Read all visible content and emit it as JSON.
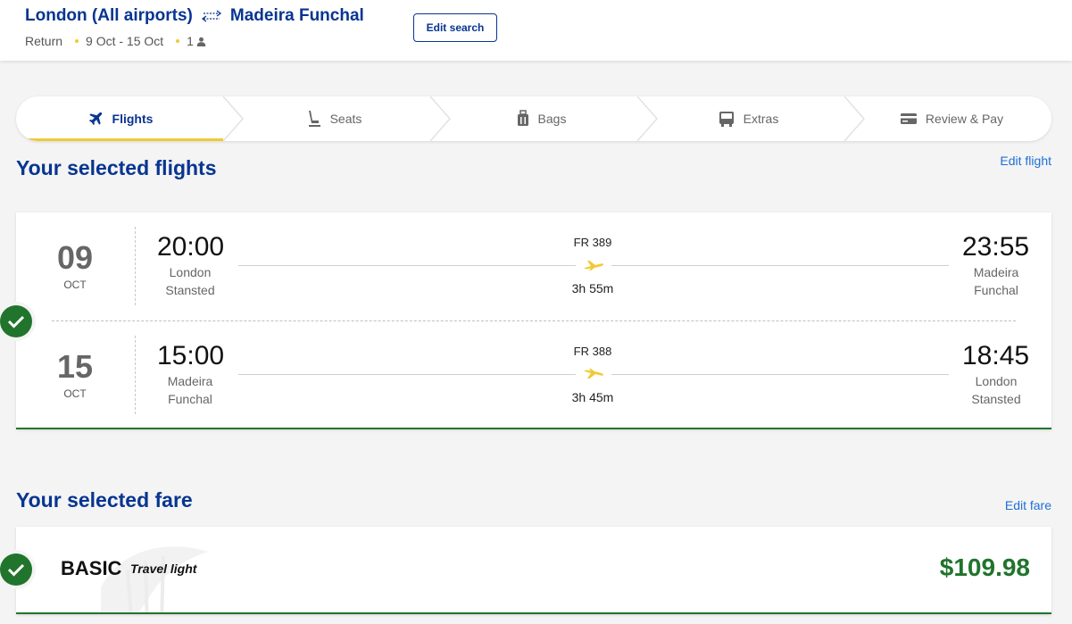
{
  "header": {
    "origin": "London (All airports)",
    "destination": "Madeira Funchal",
    "trip_type": "Return",
    "dates": "9 Oct - 15 Oct",
    "passengers": "1",
    "edit_search_label": "Edit search"
  },
  "stepper": {
    "steps": [
      {
        "label": "Flights",
        "icon": "plane-icon",
        "active": true
      },
      {
        "label": "Seats",
        "icon": "seat-icon",
        "active": false
      },
      {
        "label": "Bags",
        "icon": "bag-icon",
        "active": false
      },
      {
        "label": "Extras",
        "icon": "bus-icon",
        "active": false
      },
      {
        "label": "Review & Pay",
        "icon": "card-icon",
        "active": false
      }
    ]
  },
  "flights_section": {
    "title": "Your selected flights",
    "edit_label": "Edit flight",
    "legs": [
      {
        "day": "09",
        "month": "OCT",
        "depart_time": "20:00",
        "depart_place_line1": "London",
        "depart_place_line2": "Stansted",
        "flight_number": "FR 389",
        "duration": "3h 55m",
        "arrive_time": "23:55",
        "arrive_place_line1": "Madeira",
        "arrive_place_line2": "Funchal"
      },
      {
        "day": "15",
        "month": "OCT",
        "depart_time": "15:00",
        "depart_place_line1": "Madeira",
        "depart_place_line2": "Funchal",
        "flight_number": "FR 388",
        "duration": "3h 45m",
        "arrive_time": "18:45",
        "arrive_place_line1": "London",
        "arrive_place_line2": "Stansted"
      }
    ]
  },
  "fare_section": {
    "title": "Your selected fare",
    "edit_label": "Edit fare",
    "fare_name": "BASIC",
    "fare_tagline": "Travel light",
    "price": "$109.98"
  },
  "colors": {
    "brand_blue": "#073590",
    "accent_yellow": "#f1c933",
    "success_green": "#21742c",
    "link_blue": "#1e6fd6"
  }
}
